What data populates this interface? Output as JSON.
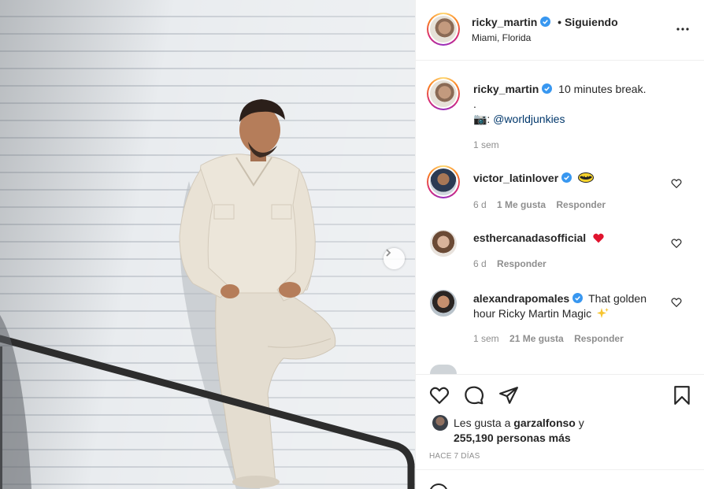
{
  "post_header": {
    "username": "ricky_martin",
    "following": "• Siguiendo",
    "location": "Miami, Florida",
    "more_icon": "ellipsis-icon"
  },
  "caption": {
    "username": "ricky_martin",
    "line1": "10 minutes break.",
    "line2": ".",
    "camera_emoji": "📷:",
    "mention": "@worldjunkies",
    "time": "1 sem"
  },
  "comments": [
    {
      "username": "victor_latinlover",
      "verified": true,
      "text": "",
      "emoji": "batman-emoji",
      "time": "6 d",
      "likes": "1 Me gusta",
      "reply": "Responder"
    },
    {
      "username": "esthercanadasofficial",
      "verified": false,
      "text": "",
      "emoji": "red-heart-emoji",
      "time": "6 d",
      "likes": "",
      "reply": "Responder"
    },
    {
      "username": "alexandrapomales",
      "verified": true,
      "text": "That golden",
      "text2": "hour Ricky Martin Magic",
      "emoji": "sparkle-emoji",
      "time": "1 sem",
      "likes": "21 Me gusta",
      "reply": "Responder"
    }
  ],
  "likes": {
    "prefix": "Les gusta a",
    "user": "garzalfonso",
    "suffix": "y",
    "count": "255,190 personas más"
  },
  "posted": "HACE 7 DÍAS",
  "colors": {
    "verified": "#3897f0",
    "heart_red": "#ed4956",
    "link": "#00376b"
  }
}
